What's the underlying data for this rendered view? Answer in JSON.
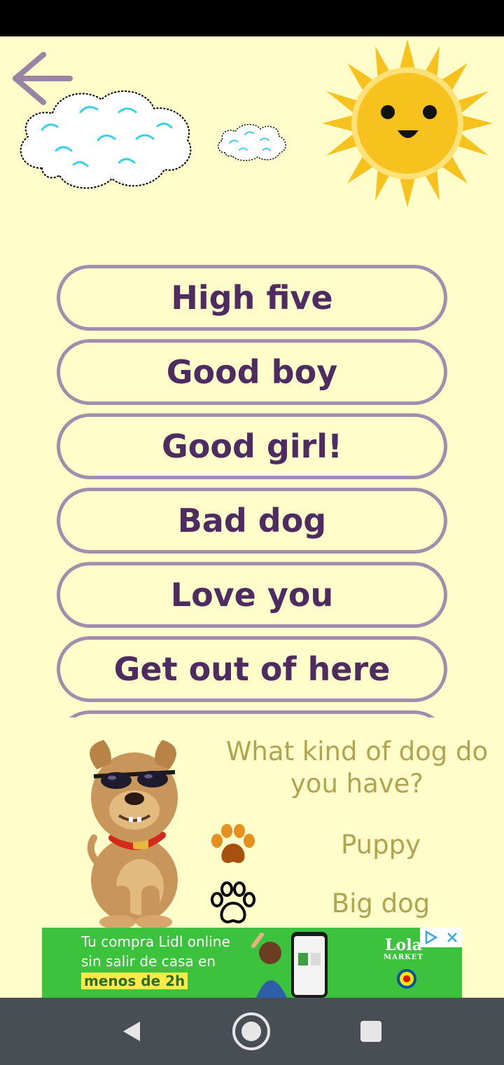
{
  "header": {
    "back_icon": "arrow-left-icon"
  },
  "decorations": {
    "cloud_icon": "cloud-icon",
    "sun_icon": "smiling-sun-icon"
  },
  "phrases": [
    {
      "label": "High five"
    },
    {
      "label": "Good boy"
    },
    {
      "label": "Good girl!"
    },
    {
      "label": "Bad dog"
    },
    {
      "label": "Love you"
    },
    {
      "label": "Get out of here"
    },
    {
      "label": ""
    }
  ],
  "dog_type": {
    "question": "What kind of dog do you have?",
    "options": [
      {
        "label": "Puppy",
        "icon": "paw-filled-icon",
        "color": "#D2690F"
      },
      {
        "label": "Big dog",
        "icon": "paw-outline-icon",
        "color": "#000000"
      }
    ]
  },
  "ad": {
    "line1": "Tu compra Lidl online",
    "line2": "sin salir de casa en",
    "highlight": "menos de 2h",
    "brand": "Lola",
    "brand_sub": "MARKET"
  },
  "colors": {
    "background": "#FFFDC9",
    "button_border": "#A28DAE",
    "button_text": "#4E2B60",
    "secondary_text": "#AFA450",
    "nav_bar": "#484E54",
    "ad_green": "#3DC23D"
  },
  "nav": {
    "back_icon": "triangle-back-icon",
    "home_icon": "circle-home-icon",
    "recents_icon": "square-recents-icon"
  }
}
